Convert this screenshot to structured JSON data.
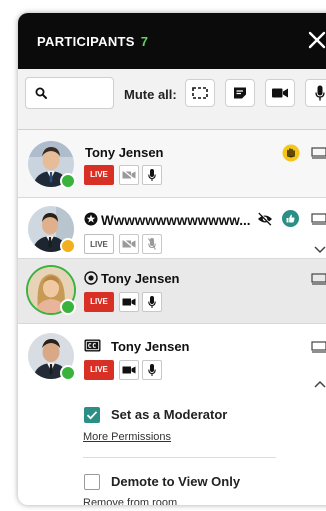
{
  "header": {
    "title": "PARTICIPANTS",
    "count": "7"
  },
  "toolbar": {
    "mute_all_label": "Mute all:"
  },
  "participants": [
    {
      "name": "Tony Jensen",
      "live_label": "LIVE",
      "status": "online",
      "hand_raised": true
    },
    {
      "name": "Wwwwwwwwwwwww...",
      "live_label": "LIVE",
      "status": "away",
      "badge": "star"
    },
    {
      "name": "Tony Jensen",
      "live_label": "LIVE",
      "status": "online",
      "badge": "presenter"
    },
    {
      "name": "Tony Jensen",
      "live_label": "LIVE",
      "status": "online",
      "badge": "cc"
    }
  ],
  "expanded": {
    "moderator_label": "Set as a Moderator",
    "moderator_checked": true,
    "more_permissions": "More Permissions",
    "demote_label": "Demote to View Only",
    "demote_checked": false,
    "remove_link": "Remove from room"
  },
  "colors": {
    "live": "#d93025",
    "online": "#39b33d",
    "away": "#f2b01e",
    "accent": "#2c8f86",
    "header_bg": "#0b0b0b"
  }
}
